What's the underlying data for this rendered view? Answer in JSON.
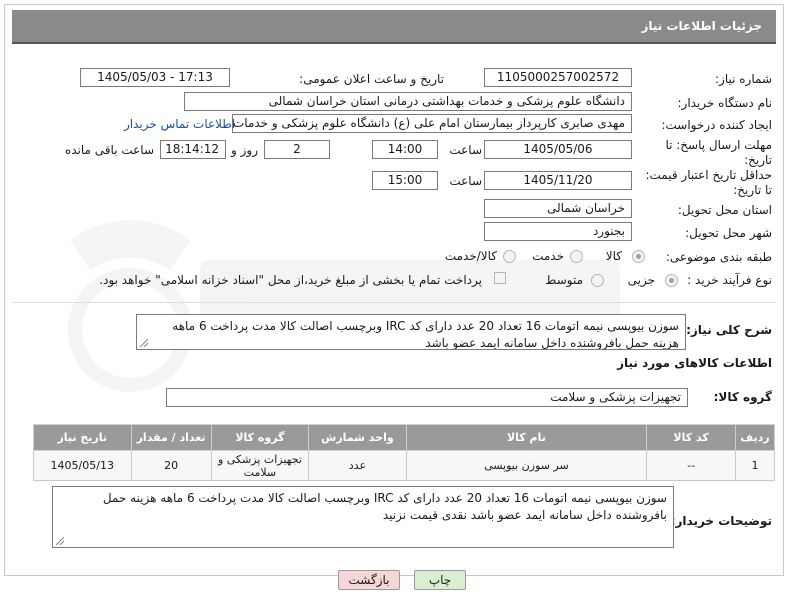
{
  "header": {
    "title": "جزئیات اطلاعات نیاز"
  },
  "fields": {
    "need_number": {
      "label": "شماره نیاز:",
      "value": "1105000257002572"
    },
    "announce_datetime": {
      "label": "تاریخ و ساعت اعلان عمومی:",
      "value": "1405/05/03 - 17:13"
    },
    "buyer_org": {
      "label": "نام دستگاه خریدار:",
      "value": "دانشگاه علوم پزشکی و خدمات بهداشتی درمانی استان خراسان شمالی"
    },
    "requester": {
      "label": "ایجاد کننده درخواست:",
      "value": "مهدی صابری کارپرداز بیمارستان امام علی (ع) دانشگاه علوم پزشکی و خدمات بهداشتی",
      "contact_link": "اطلاعات تماس خریدار"
    },
    "reply_deadline": {
      "label_line1": "مهلت ارسال پاسخ: تا",
      "label_line2": "تاریخ:",
      "date": "1405/05/06",
      "time_label": "ساعت",
      "time": "14:00",
      "days": "2",
      "days_label": "روز و",
      "remaining": "18:14:12",
      "remaining_label": "ساعت باقی مانده"
    },
    "price_validity": {
      "label_line1": "حداقل تاریخ اعتبار قیمت:",
      "label_line2": "تا تاریخ:",
      "date": "1405/11/20",
      "time_label": "ساعت",
      "time": "15:00"
    },
    "delivery_province": {
      "label": "استان محل تحویل:",
      "value": "خراسان شمالی"
    },
    "delivery_city": {
      "label": "شهر محل تحویل:",
      "value": "بجنورد"
    },
    "category": {
      "label": "طبقه بندی موضوعی:",
      "options": [
        "کالا",
        "خدمت",
        "کالا/خدمت"
      ],
      "selected": "کالا"
    },
    "purchase_process": {
      "label": "نوع فرآیند خرید :",
      "options": [
        "جزیی",
        "متوسط"
      ],
      "selected": "جزیی",
      "payment_note": "پرداخت تمام یا بخشی از مبلغ خرید،از محل \"اسناد خزانه اسلامی\" خواهد بود."
    }
  },
  "general_description": {
    "label": "شرح کلی نیاز:",
    "text": "سوزن بیوپسی نیمه اتومات 16 تعداد 20 عدد دارای کد IRC وبرچسب اصالت کالا مدت پرداخت 6 ماهه هزینه حمل بافروشنده داخل سامانه ایمد عضو باشد"
  },
  "goods_section": {
    "title": "اطلاعات کالاهای مورد نیاز",
    "group_label": "گروه کالا:",
    "group_value": "تجهیزات پزشکی و سلامت"
  },
  "table": {
    "headers": [
      "ردیف",
      "کد کالا",
      "نام کالا",
      "واحد شمارش",
      "گروه کالا",
      "تعداد / مقدار",
      "تاریخ نیاز"
    ],
    "rows": [
      [
        "1",
        "--",
        "سر سوزن بیوپسی",
        "عدد",
        "تجهیزات پزشکی و سلامت",
        "20",
        "1405/05/13"
      ]
    ]
  },
  "buyer_notes": {
    "label": "توضیحات خریدار:",
    "text": "سوزن بیوپسی نیمه اتومات 16 تعداد 20 عدد دارای کد IRC وبرچسب اصالت کالا مدت پرداخت 6 ماهه هزینه حمل بافروشنده داخل سامانه ایمد عضو باشد نقدی قیمت نزنید"
  },
  "buttons": {
    "print": "چاپ",
    "back": "بازگشت"
  },
  "colors": {
    "header_bg": "#8a8a8a",
    "table_header_bg": "#9a9a9a",
    "link": "#1c4f9c",
    "back_btn_bg": "#f6d6d6",
    "print_btn_bg": "#d8f0d0"
  }
}
